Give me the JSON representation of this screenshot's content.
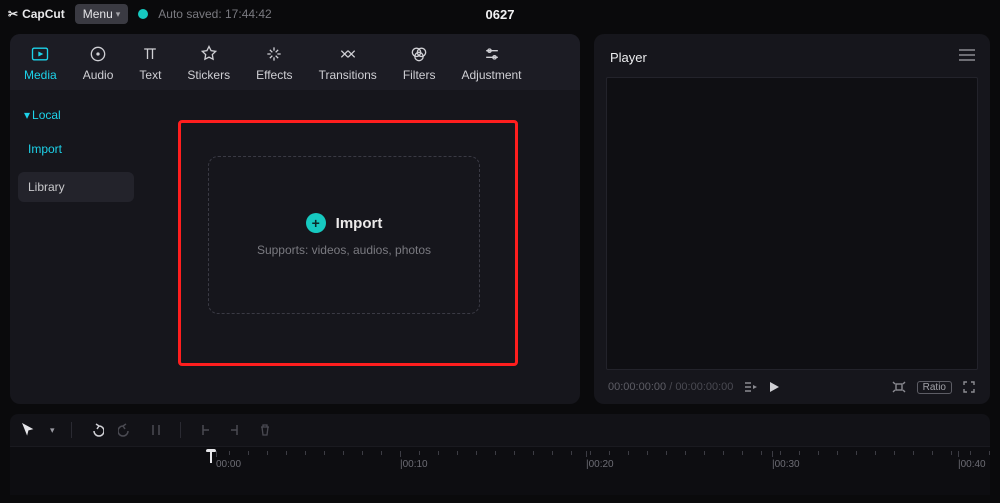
{
  "app": {
    "name": "CapCut"
  },
  "menu": {
    "label": "Menu"
  },
  "autosave": {
    "text": "Auto saved: 17:44:42"
  },
  "project": {
    "title": "0627"
  },
  "tabs": [
    {
      "label": "Media"
    },
    {
      "label": "Audio"
    },
    {
      "label": "Text"
    },
    {
      "label": "Stickers"
    },
    {
      "label": "Effects"
    },
    {
      "label": "Transitions"
    },
    {
      "label": "Filters"
    },
    {
      "label": "Adjustment"
    }
  ],
  "sidebar": {
    "header": "Local",
    "items": [
      {
        "label": "Import"
      },
      {
        "label": "Library"
      }
    ]
  },
  "import": {
    "label": "Import",
    "subtext": "Supports: videos, audios, photos"
  },
  "player": {
    "title": "Player",
    "current": "00:00:00:00",
    "duration": "00:00:00:00",
    "ratio_label": "Ratio"
  },
  "timeline": {
    "ticks": [
      "00:00",
      "|00:10",
      "|00:20",
      "|00:30",
      "|00:40"
    ]
  }
}
